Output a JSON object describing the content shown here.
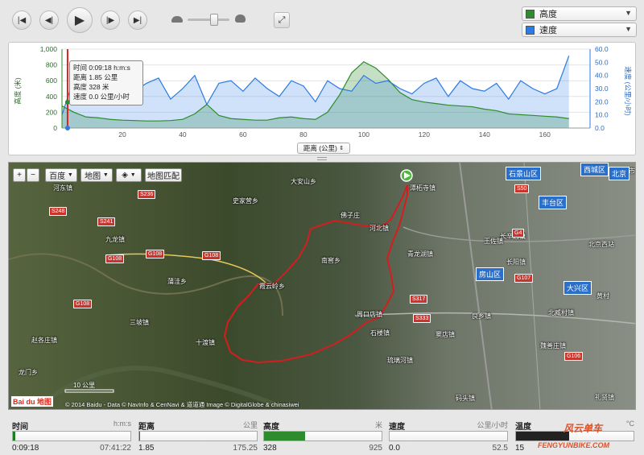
{
  "toolbar": {
    "zoom_icon": "expand-icon"
  },
  "selectors": [
    {
      "label": "高度",
      "color": "#2e8b2e"
    },
    {
      "label": "速度",
      "color": "#2a7be4"
    }
  ],
  "chart": {
    "tooltip": {
      "line1": "时间 0:09:18 h:m:s",
      "line2": "距离 1.85 公里",
      "line3": "高度 328 米",
      "line4": "速度 0.0 公里/小时"
    },
    "y_left_label": "高度 (米)",
    "y_right_label": "速度 (公里/小时)",
    "y_left_ticks": [
      "1,000",
      "800",
      "600",
      "400",
      "200",
      "0"
    ],
    "y_right_ticks": [
      "60.0",
      "50.0",
      "40.0",
      "30.0",
      "20.0",
      "10.0",
      "0.0"
    ],
    "x_ticks": [
      "20",
      "40",
      "60",
      "80",
      "100",
      "120",
      "140",
      "160"
    ],
    "x_selector": "距离 (公里)"
  },
  "chart_data": {
    "type": "line",
    "x": [
      0,
      4,
      8,
      12,
      16,
      20,
      24,
      28,
      32,
      36,
      40,
      44,
      48,
      52,
      56,
      60,
      64,
      68,
      72,
      76,
      80,
      84,
      88,
      92,
      96,
      100,
      104,
      108,
      112,
      116,
      120,
      124,
      128,
      132,
      136,
      140,
      144,
      148,
      152,
      156,
      160,
      164,
      168
    ],
    "series": [
      {
        "name": "高度",
        "values": [
          280,
          200,
          140,
          130,
          110,
          100,
          95,
          90,
          90,
          95,
          110,
          180,
          300,
          160,
          120,
          110,
          100,
          100,
          130,
          140,
          120,
          110,
          200,
          420,
          700,
          840,
          760,
          620,
          450,
          360,
          330,
          310,
          290,
          280,
          270,
          240,
          220,
          180,
          170,
          160,
          150,
          140,
          120
        ]
      },
      {
        "name": "速度",
        "values": [
          10,
          38,
          30,
          20,
          34,
          36,
          28,
          34,
          38,
          22,
          30,
          40,
          18,
          34,
          36,
          28,
          38,
          30,
          24,
          36,
          32,
          20,
          36,
          30,
          28,
          40,
          34,
          36,
          30,
          26,
          34,
          38,
          24,
          36,
          30,
          28,
          34,
          22,
          36,
          30,
          26,
          30,
          55
        ]
      }
    ],
    "xlabel": "距离 (公里)",
    "ylabel": "高度 (米)",
    "y2label": "速度 (公里/小时)",
    "xlim": [
      0,
      175
    ],
    "ylim": [
      0,
      1000
    ],
    "y2lim": [
      0,
      60
    ]
  },
  "map": {
    "zoom_in": "+",
    "zoom_out": "−",
    "provider": "百度",
    "maptype": "地图",
    "layers": "layers-icon",
    "match": "地图匹配",
    "scale": "10 公里",
    "copyright": "© 2014 Baidu - Data © NavInfo & CenNavi & 道道通 Image © DigitalGlobe & chinasiwei",
    "logo": "Bai du 地图",
    "places": [
      {
        "t": "河东镇"
      },
      {
        "t": "大安山乡"
      },
      {
        "t": "史家营乡"
      },
      {
        "t": "潭柘寺镇"
      },
      {
        "t": "佛子庄"
      },
      {
        "t": "河北镇"
      },
      {
        "t": "九龙镇"
      },
      {
        "t": "南窖乡"
      },
      {
        "t": "青龙湖镇"
      },
      {
        "t": "蒲洼乡"
      },
      {
        "t": "霞云岭乡"
      },
      {
        "t": "长阳镇"
      },
      {
        "t": "三坡镇"
      },
      {
        "t": "周口店镇"
      },
      {
        "t": "良乡镇"
      },
      {
        "t": "十渡镇"
      },
      {
        "t": "石楼镇"
      },
      {
        "t": "窦店镇"
      },
      {
        "t": "赵各庄镇"
      },
      {
        "t": "琉璃河镇"
      },
      {
        "t": "龙门乡"
      },
      {
        "t": "码头镇"
      },
      {
        "t": "长辛店镇"
      },
      {
        "t": "王佐镇"
      },
      {
        "t": "北京西站"
      },
      {
        "t": "黄村"
      },
      {
        "t": "北臧村镇"
      },
      {
        "t": "魏善庄镇"
      },
      {
        "t": "礼贤镇"
      },
      {
        "t": "北京市"
      }
    ],
    "roads": [
      {
        "t": "G108"
      },
      {
        "t": "G108"
      },
      {
        "t": "G108"
      },
      {
        "t": "G108"
      },
      {
        "t": "S241"
      },
      {
        "t": "S248"
      },
      {
        "t": "S236"
      },
      {
        "t": "S317"
      },
      {
        "t": "S333"
      },
      {
        "t": "S50"
      },
      {
        "t": "G4"
      },
      {
        "t": "G107"
      },
      {
        "t": "G106"
      }
    ],
    "districts": [
      {
        "t": "石景山区"
      },
      {
        "t": "丰台区"
      },
      {
        "t": "房山区"
      },
      {
        "t": "大兴区"
      },
      {
        "t": "西城区"
      },
      {
        "t": "北京"
      }
    ]
  },
  "stats": [
    {
      "label": "时间",
      "unit": "h:m:s",
      "value": "0:09:18",
      "max": "07:41:22",
      "pct": 0.02,
      "color": "#1e7d1e"
    },
    {
      "label": "距离",
      "unit": "公里",
      "value": "1.85",
      "max": "175.25",
      "pct": 0.01,
      "color": "#1e7d1e"
    },
    {
      "label": "高度",
      "unit": "米",
      "value": "328",
      "max": "925",
      "pct": 0.35,
      "color": "#2e8b2e"
    },
    {
      "label": "速度",
      "unit": "公里/小时",
      "value": "0.0",
      "max": "52.5",
      "pct": 0,
      "color": "#2a7be4"
    },
    {
      "label": "温度",
      "unit": "°C",
      "value": "15",
      "max": "",
      "pct": 0.45,
      "color": "#222"
    }
  ],
  "watermark": "风云单车",
  "watermark_url": "FENGYUNBIKE.COM"
}
